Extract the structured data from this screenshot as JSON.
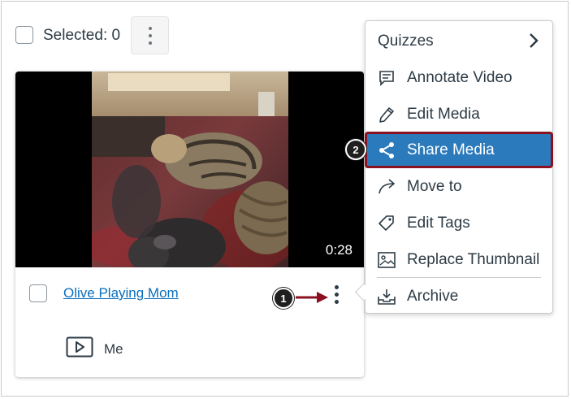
{
  "toolbar": {
    "selected_label": "Selected: 0"
  },
  "card": {
    "duration": "0:28",
    "title": "Olive Playing Mom",
    "owner": "Me"
  },
  "callouts": {
    "one": "1",
    "two": "2"
  },
  "menu": {
    "items": [
      {
        "label": "Quizzes",
        "icon": "chevron-right-icon"
      },
      {
        "label": "Annotate Video",
        "icon": "comment-icon"
      },
      {
        "label": "Edit Media",
        "icon": "pencil-icon"
      },
      {
        "label": "Share Media",
        "icon": "share-icon",
        "highlighted": true
      },
      {
        "label": "Move to",
        "icon": "move-arrow-icon"
      },
      {
        "label": "Edit Tags",
        "icon": "tag-icon"
      },
      {
        "label": "Replace Thumbnail",
        "icon": "image-icon"
      },
      {
        "label": "Archive",
        "icon": "archive-icon"
      }
    ]
  },
  "colors": {
    "highlight_bg": "#2b7abc",
    "highlight_border": "#8b1020",
    "link": "#0b6ebb",
    "annotation_arrow": "#8b1020"
  }
}
